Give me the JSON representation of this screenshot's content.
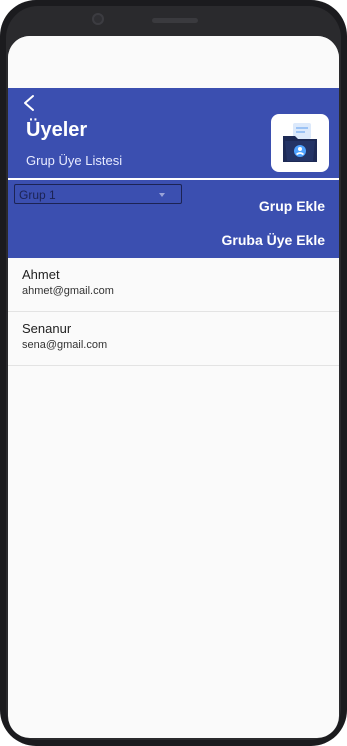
{
  "header": {
    "title": "Üyeler",
    "subtitle": "Grup Üye Listesi"
  },
  "controls": {
    "group_select_value": "Grup 1",
    "add_group_label": "Grup Ekle",
    "add_member_label": "Gruba Üye Ekle"
  },
  "members": [
    {
      "name": "Ahmet",
      "email": "ahmet@gmail.com"
    },
    {
      "name": "Senanur",
      "email": "sena@gmail.com"
    }
  ],
  "colors": {
    "primary": "#3b4fb0",
    "app_icon_dark": "#1d2a55",
    "app_icon_light": "#4fa3ff"
  },
  "icons": {
    "back": "chevron-left-icon",
    "app": "folder-user-icon",
    "dropdown": "caret-down-icon"
  }
}
